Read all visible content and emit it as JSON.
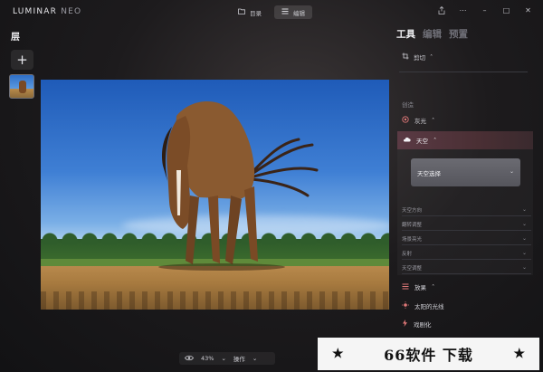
{
  "app": {
    "logo_main": "LUMINAR",
    "logo_sub": "NEO"
  },
  "mode_tabs": [
    {
      "label": "目录",
      "icon": "folder-icon"
    },
    {
      "label": "编辑",
      "icon": "menu-icon"
    }
  ],
  "window_controls": [
    "share-icon",
    "more-icon",
    "minimize-icon",
    "maximize-icon",
    "close-icon"
  ],
  "layers": {
    "title": "层",
    "add_symbol": "+"
  },
  "zoom": {
    "value": "43%",
    "action_label": "操作"
  },
  "right_panel": {
    "tabs": [
      {
        "label": "工具",
        "active": true
      },
      {
        "label": "编辑",
        "active": false
      },
      {
        "label": "预置",
        "active": false
      }
    ],
    "crop_label": "剪切",
    "section_label": "创造",
    "light_label": "灰光",
    "sky_label": "天空",
    "sky_selection_label": "天空选择",
    "sky_sub_items": [
      "天空方向",
      "翻转调整",
      "场景亮光",
      "反射",
      "天空调整"
    ],
    "rays_label": "放果",
    "sunrays_label": "太阳的光线",
    "drama_label": "戏剧化"
  },
  "watermark": {
    "star": "★",
    "text": "66软件 下载"
  },
  "colors": {
    "accent_sky": "#5a3a44",
    "panel_bg": "#1d1b1d"
  }
}
